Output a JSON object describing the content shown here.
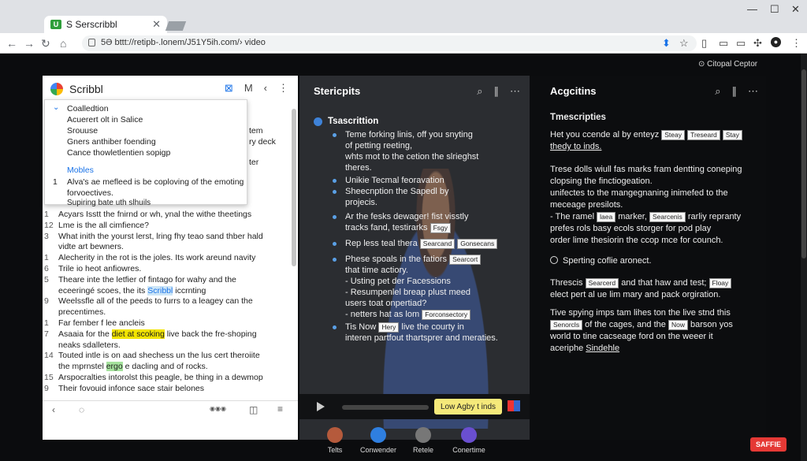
{
  "browser": {
    "tab_title": "S Serscribbl",
    "tab_favicon": "U",
    "url": "bttt://retipb-.lonem/J51Y5ih.com/› video",
    "url_prefix": "5Ə"
  },
  "left_panel": {
    "title": "Scribbl",
    "icons": [
      "expand-icon",
      "m-icon",
      "back-icon",
      "more-icon"
    ],
    "dropdown": {
      "items": [
        "Coalledtion",
        "Acuerert olt in Salice",
        "Srouuse",
        "Gners anthiber foending",
        "Cance thowletlentien sopigp"
      ],
      "section_label": "Mobles",
      "section_lines": [
        "Alva's ae mefleed is be coploving of the emoting",
        "forvoectives.",
        "Supiring bate uth slhuils"
      ]
    },
    "side_snippets": [
      "tem",
      "ry deck",
      "ter"
    ],
    "lines": [
      {
        "num": "1",
        "text": "Acyars Isstt the fnirnd or wh, ynal the withe theetings"
      },
      {
        "num": "12",
        "text": "Lme is the all cimfience?"
      },
      {
        "num": "3",
        "text": "What inith the yourst lerst, lring fhy teao sand thber hald"
      },
      {
        "num": "",
        "text": "vidte art bewners."
      },
      {
        "num": "1",
        "text": "Alecherity in the rot is the joles. Its work areund navity"
      },
      {
        "num": "6",
        "text": "Trile io heot anfiowres."
      },
      {
        "num": "5",
        "text": "Theare inte the letfier of fintago for wahy and the"
      },
      {
        "num": "",
        "text": "eceeringé scoes, the its",
        "hl_blue": "Scribbl",
        "after": "iccrnting"
      },
      {
        "num": "9",
        "text": "Weelssfle all of the peeds to furrs to a leagey can the"
      },
      {
        "num": "",
        "text": "precentimes."
      },
      {
        "num": "1",
        "text": "Far fember f lee ancleis"
      },
      {
        "num": "7",
        "text": "Asaaia for the",
        "hl_yellow": "diet at scoking",
        "after": "live back the fre-shoping"
      },
      {
        "num": "",
        "text": "neaks sdalleters."
      },
      {
        "num": "14",
        "text": "Touted intle is on aad shechess un the lus cert theroiite"
      },
      {
        "num": "",
        "text": "the mprnstel",
        "hl_green": "ergo",
        "after": "e dacling and of rocks."
      },
      {
        "num": "15",
        "text": "Arspocralties intorolst this peagle, be thing in a dewmop"
      },
      {
        "num": "9",
        "text": "Their fovouid infonce sace stair belones"
      }
    ],
    "footer": {
      "left": "‹",
      "mid": "◌",
      "dots": "◉◉◉",
      "right1": "◫",
      "right2": "≡"
    }
  },
  "middle_panel": {
    "title": "Stericpits",
    "section": "Tsascrittion",
    "bullets": [
      {
        "lines": [
          "Teme forking linis, off you snyting",
          "of petting reeting,",
          "whts mot to the cetion the slrieghst",
          "theres."
        ]
      },
      {
        "lines": [
          "Unikie Tecmal feoravation"
        ]
      },
      {
        "lines": [
          "Sheecnption the Sapedl by",
          "projecis."
        ]
      },
      {
        "lines": [
          "Ar the fesks dewager! fist visstly",
          "tracks fand, testirarks"
        ],
        "tag": "Fsgy"
      },
      {
        "lines": [
          "Rep less teal thera"
        ],
        "tags": [
          "Searcand",
          "Gonsecans"
        ]
      },
      {
        "lines": [
          "Phese spoals in the fatiors",
          "that time actiory.",
          "- Usting pet der Facessions",
          "- Resumpenlel breap plust meed",
          "users toat onpertiad?",
          "- netters hat as lom"
        ],
        "tags2": [
          "Searcort",
          "Forconsectory"
        ]
      },
      {
        "lines": [
          "Tis Now",
          "live the courty in",
          "interen partfout thartsprer and meraties."
        ],
        "tag": "Hery"
      }
    ],
    "player": {
      "cta": "Low Agby t inds"
    }
  },
  "right_panel": {
    "top_label": "Citopal Ceptor",
    "title": "Acgcitins",
    "blocks": {
      "title": "Tmescripties",
      "p1": [
        "Het you ccende al by enteyz",
        "thedy to inds."
      ],
      "p1_tags": [
        "Steay",
        "Treseard",
        "Stay"
      ],
      "p2": [
        "Trese dolls wiull fas marks fram dentting coneping",
        "clopsing the finctiogeation.",
        "unifectes to the mangegnaning inimefed to the",
        "meceage presilots.",
        "- The ramel",
        "marker,",
        "rarliy repranty",
        "prefes rols basy ecols storger for pod play",
        "order lime thesiorin the ccop mce for counch."
      ],
      "p2_tags": [
        "laea",
        "Searcenis"
      ],
      "p3": "Sperting coflie aronect.",
      "p4": [
        "Threscis",
        "and that haw and test;",
        "elect pert al ue lim mary and pack orgiration."
      ],
      "p4_tags": [
        "Searcerd",
        "Floay"
      ],
      "p5": [
        "Tive spying imps tam lihes ton the live stnd this",
        "of the cages, and the",
        "barson yos",
        "world to tine cacseage ford on the weeer it",
        "aceriphe",
        "Sindehle"
      ],
      "p5_tags": [
        "Senorcls",
        "Now"
      ]
    },
    "save_button": "SAFFIE"
  },
  "dock": [
    {
      "label": "Telts",
      "icon": "avatar-icon",
      "color": "#b55a3c"
    },
    {
      "label": "Conwender",
      "icon": "a-icon",
      "color": "#2f7fe0"
    },
    {
      "label": "Retele",
      "icon": "star-icon",
      "color": "#777777"
    },
    {
      "label": "Conertime",
      "icon": "circle-app-icon",
      "color": "#6a4fd0"
    }
  ]
}
